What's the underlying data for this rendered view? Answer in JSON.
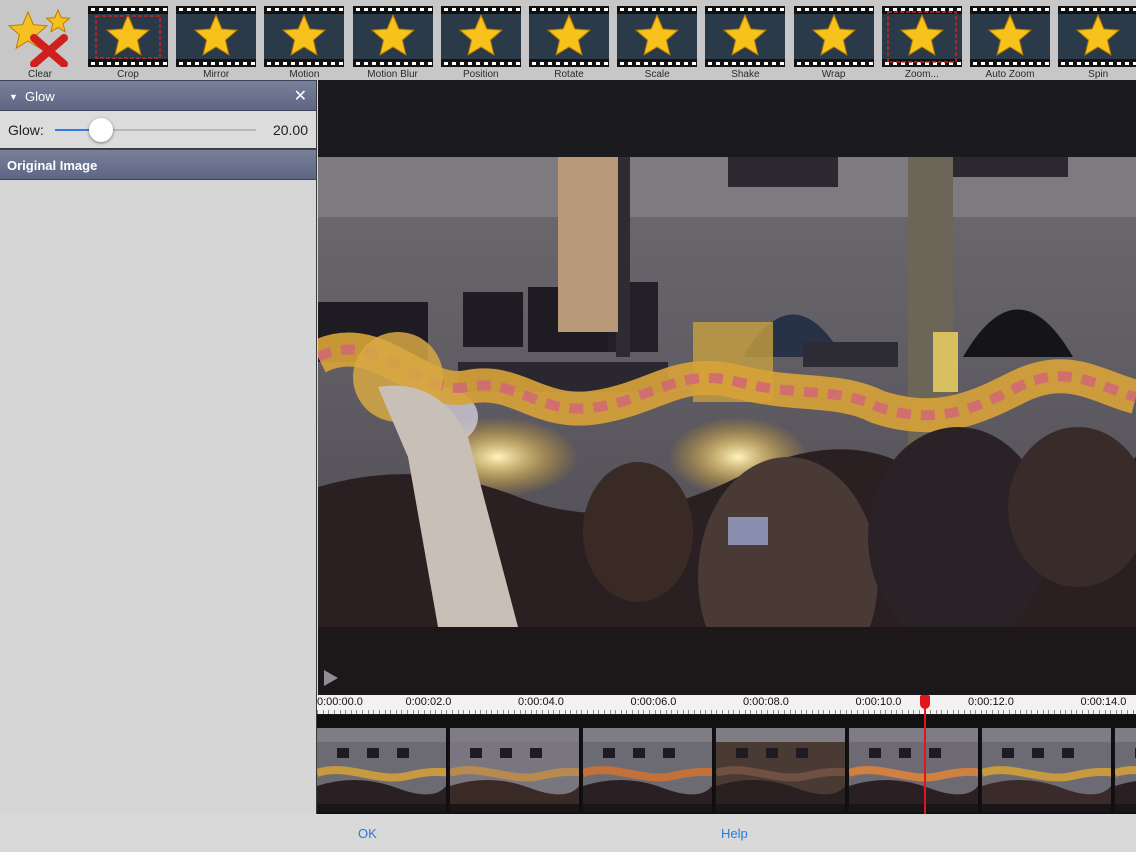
{
  "toolbar": {
    "tools": [
      {
        "label": "Clear",
        "icon": "clear-star-icon"
      },
      {
        "label": "Crop",
        "icon": "crop-star-icon"
      },
      {
        "label": "Mirror",
        "icon": "mirror-star-icon"
      },
      {
        "label": "Motion",
        "icon": "motion-star-icon"
      },
      {
        "label": "Motion Blur",
        "icon": "motion-blur-star-icon"
      },
      {
        "label": "Position",
        "icon": "position-star-icon"
      },
      {
        "label": "Rotate",
        "icon": "rotate-star-icon"
      },
      {
        "label": "Scale",
        "icon": "scale-star-icon"
      },
      {
        "label": "Shake",
        "icon": "shake-star-icon"
      },
      {
        "label": "Wrap",
        "icon": "wrap-star-icon"
      },
      {
        "label": "Zoom...",
        "icon": "zoom-star-icon"
      },
      {
        "label": "Auto Zoom",
        "icon": "auto-zoom-star-icon"
      },
      {
        "label": "Spin",
        "icon": "spin-star-icon"
      }
    ]
  },
  "effect_panel": {
    "title": "Glow",
    "close_icon": "close-icon",
    "parameter": {
      "label": "Glow:",
      "value": "20.00",
      "slider_fraction": 0.23
    },
    "original_label": "Original Image"
  },
  "timeline": {
    "ticks": [
      "0:00:00.0",
      "0:00:02.0",
      "0:00:04.0",
      "0:00:06.0",
      "0:00:08.0",
      "0:00:10.0",
      "0:00:12.0",
      "0:00:14.0"
    ],
    "playhead_seconds": 10.8
  },
  "bottom": {
    "ok_label": "OK",
    "help_label": "Help"
  },
  "colors": {
    "accent": "#2f7fe6",
    "playhead": "#e1161c",
    "link": "#2a7bdc",
    "panel_header": "#6a7290"
  }
}
